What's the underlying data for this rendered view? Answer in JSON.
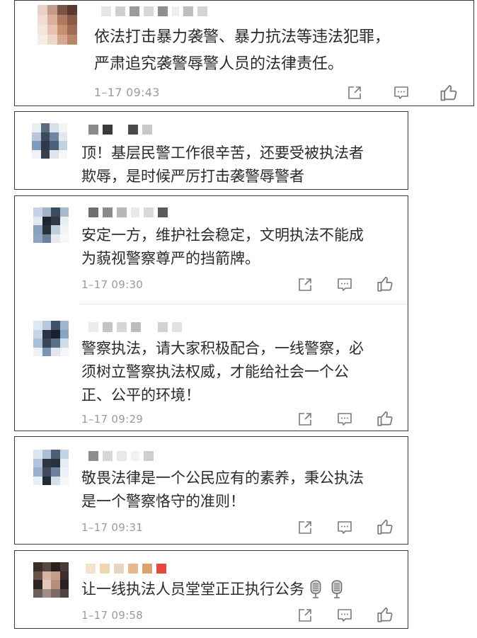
{
  "comments": [
    {
      "text_line1": "依法打击暴力袭警、暴力抗法等违法犯罪，",
      "text_line2": "严肃追究袭警辱警人员的法律责任。",
      "time": "1–17 09:43"
    },
    {
      "text_line1": "顶！基层民警工作很辛苦，还要受被执法者",
      "text_line2": "欺辱，是时候严厉打击袭警辱警者"
    },
    {
      "text_line1": "安定一方，维护社会稳定，文明执法不能成",
      "text_line2": "为藐视警察尊严的挡箭牌。",
      "time": "1–17 09:30"
    },
    {
      "text_line1": "警察执法，请大家积极配合，一线警察，必",
      "text_line2": "须树立警察执法权威，才能给社会一个公",
      "text_line3": "正、公平的环境！",
      "time": "1–17 09:29"
    },
    {
      "text_line1": "敬畏法律是一个公民应有的素养，秉公执法",
      "text_line2": "是一个警察恪守的准则！",
      "time": "1–17 09:31"
    },
    {
      "text_line1": "让一线执法人员堂堂正正执行公务",
      "time": "1–17 09:58"
    }
  ],
  "icons": {
    "share": "share-icon",
    "comment": "comment-icon",
    "like": "thumbs-up-icon",
    "microphone": "microphone-emoji"
  }
}
